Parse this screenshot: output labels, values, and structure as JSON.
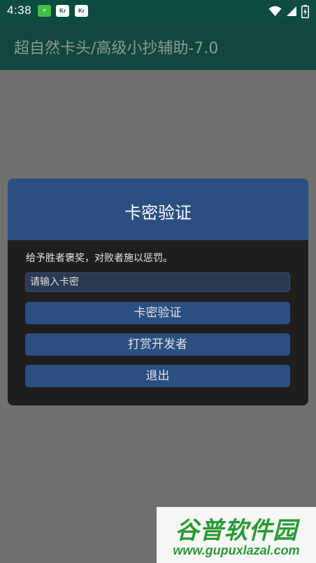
{
  "status_bar": {
    "time": "4:38",
    "notif_badge_1": "Kr",
    "notif_badge_2": "Kr",
    "icons": [
      "app-notification-icon",
      "kr-notification-icon",
      "kr-notification-icon",
      "wifi-icon",
      "signal-icon",
      "battery-charging-icon"
    ]
  },
  "app_bar": {
    "title": "超自然卡头/高级小抄辅助-7.0"
  },
  "dialog": {
    "title": "卡密验证",
    "message": "给予胜者褒奖，对败者施以惩罚。",
    "key_input": {
      "placeholder": "请输入卡密",
      "value": ""
    },
    "buttons": {
      "verify": "卡密验证",
      "reward": "打赏开发者",
      "exit": "退出"
    }
  },
  "watermark": {
    "brand": "谷普软件园",
    "url": "www.gupuxlazal.com"
  },
  "colors": {
    "status_bar": "#0d4a3f",
    "app_bar": "#11463c",
    "scrim": "#707070",
    "dialog_header": "#2c4e80",
    "dialog_body": "#1e1e1e",
    "button": "#2c4e80",
    "watermark_green": "#2a9a35"
  }
}
